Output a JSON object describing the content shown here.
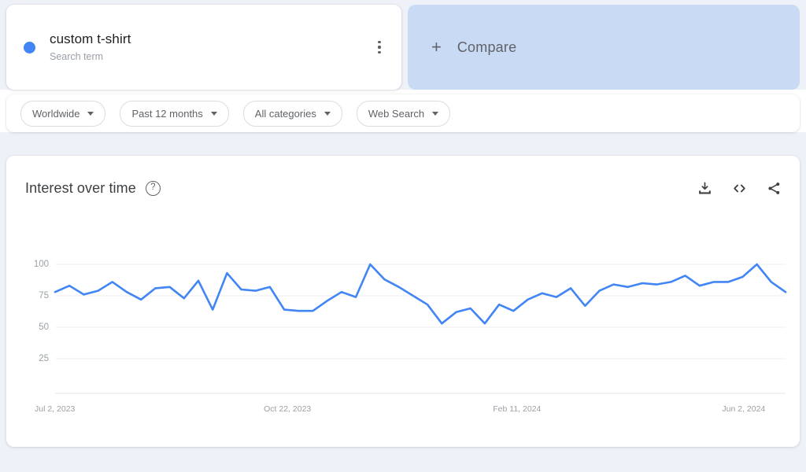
{
  "search_term": {
    "label": "custom t-shirt",
    "sublabel": "Search term",
    "dot_color": "#4285f4",
    "menu_icon": "more-vert-icon"
  },
  "compare": {
    "label": "Compare",
    "plus": "+"
  },
  "filters": [
    {
      "label": "Worldwide",
      "name": "location"
    },
    {
      "label": "Past 12 months",
      "name": "time-range"
    },
    {
      "label": "All categories",
      "name": "category"
    },
    {
      "label": "Web Search",
      "name": "search-type"
    }
  ],
  "chart_panel": {
    "title": "Interest over time",
    "help_glyph": "?",
    "actions": [
      {
        "name": "download-icon",
        "title": "download"
      },
      {
        "name": "embed-code-icon",
        "title": "embed"
      },
      {
        "name": "share-icon",
        "title": "share"
      }
    ]
  },
  "chart_data": {
    "type": "line",
    "title": "Interest over time",
    "xlabel": "",
    "ylabel": "",
    "ylim": [
      0,
      108
    ],
    "yticks": [
      25,
      50,
      75,
      100
    ],
    "grid": true,
    "legend": [
      "custom t-shirt"
    ],
    "line_color": "#4285f4",
    "xtick_labels": [
      "Jul 2, 2023",
      "Oct 22, 2023",
      "Feb 11, 2024",
      "Jun 2, 2024"
    ],
    "xtick_index": [
      0,
      16,
      32,
      48
    ],
    "x": [
      "Jul 2, 2023",
      "Jul 9, 2023",
      "Jul 16, 2023",
      "Jul 23, 2023",
      "Jul 30, 2023",
      "Aug 6, 2023",
      "Aug 13, 2023",
      "Aug 20, 2023",
      "Aug 27, 2023",
      "Sep 3, 2023",
      "Sep 10, 2023",
      "Sep 17, 2023",
      "Sep 24, 2023",
      "Oct 1, 2023",
      "Oct 8, 2023",
      "Oct 15, 2023",
      "Oct 22, 2023",
      "Oct 29, 2023",
      "Nov 5, 2023",
      "Nov 12, 2023",
      "Nov 19, 2023",
      "Nov 26, 2023",
      "Dec 3, 2023",
      "Dec 10, 2023",
      "Dec 17, 2023",
      "Dec 24, 2023",
      "Dec 31, 2023",
      "Jan 7, 2024",
      "Jan 14, 2024",
      "Jan 21, 2024",
      "Jan 28, 2024",
      "Feb 4, 2024",
      "Feb 11, 2024",
      "Feb 18, 2024",
      "Feb 25, 2024",
      "Mar 3, 2024",
      "Mar 10, 2024",
      "Mar 17, 2024",
      "Mar 24, 2024",
      "Mar 31, 2024",
      "Apr 7, 2024",
      "Apr 14, 2024",
      "Apr 21, 2024",
      "Apr 28, 2024",
      "May 5, 2024",
      "May 12, 2024",
      "May 19, 2024",
      "May 26, 2024",
      "Jun 2, 2024",
      "Jun 9, 2024",
      "Jun 16, 2024",
      "Jun 23, 2024"
    ],
    "values": [
      78,
      83,
      76,
      79,
      86,
      78,
      72,
      81,
      82,
      73,
      87,
      64,
      93,
      80,
      79,
      82,
      64,
      63,
      63,
      71,
      78,
      74,
      100,
      88,
      82,
      75,
      68,
      53,
      62,
      65,
      53,
      68,
      63,
      72,
      77,
      74,
      81,
      67,
      79,
      84,
      82,
      85,
      84,
      86,
      91,
      83,
      86,
      86,
      90,
      100,
      86,
      78
    ]
  }
}
